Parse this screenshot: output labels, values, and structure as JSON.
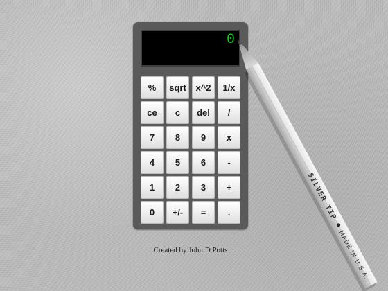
{
  "calculator": {
    "display": "0",
    "keys": [
      "%",
      "sqrt",
      "x^2",
      "1/x",
      "ce",
      "c",
      "del",
      "/",
      "7",
      "8",
      "9",
      "x",
      "4",
      "5",
      "6",
      "-",
      "1",
      "2",
      "3",
      "+",
      "0",
      "+/-",
      "=",
      "."
    ]
  },
  "credit": "Created by John D Potts",
  "pencil": {
    "brand": "SILVER TIP",
    "made_in": "MADE IN U.S.A."
  },
  "colors": {
    "background": "#bdbdbd",
    "body": "#5a5a5a",
    "display_bg": "#000000",
    "display_text": "#19c219",
    "key_face": "#f2f2f2"
  }
}
